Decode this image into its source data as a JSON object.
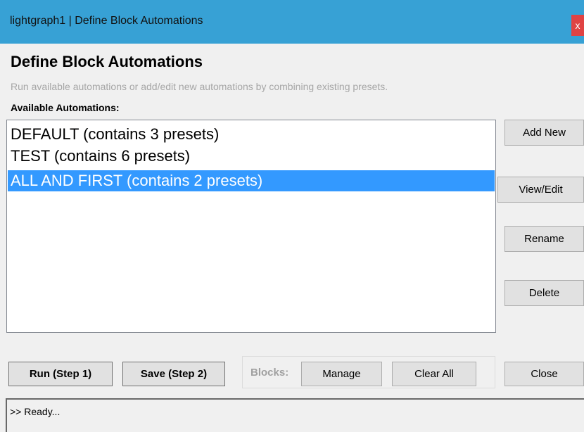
{
  "window": {
    "title": "lightgraph1 | Define Block Automations",
    "close_glyph": "x"
  },
  "dialog": {
    "heading": "Define Block Automations",
    "subtitle": "Run available automations or add/edit new automations by combining existing presets.",
    "list_label": "Available Automations:"
  },
  "automations": [
    {
      "label": "DEFAULT (contains 3 presets)",
      "selected": false
    },
    {
      "label": "TEST (contains 6 presets)",
      "selected": false
    },
    {
      "label": "ALL AND FIRST (contains 2 presets)",
      "selected": true
    }
  ],
  "side_buttons": {
    "add_new": "Add New",
    "view_edit": "View/Edit",
    "rename": "Rename",
    "delete": "Delete"
  },
  "bottom": {
    "run": "Run (Step 1)",
    "save": "Save (Step 2)",
    "blocks_label": "Blocks:",
    "manage": "Manage",
    "clear_all": "Clear All",
    "close": "Close"
  },
  "status": {
    "text": ">> Ready..."
  },
  "colors": {
    "titlebar": "#37a1d5",
    "selection": "#3399ff",
    "close_button": "#e04343"
  }
}
